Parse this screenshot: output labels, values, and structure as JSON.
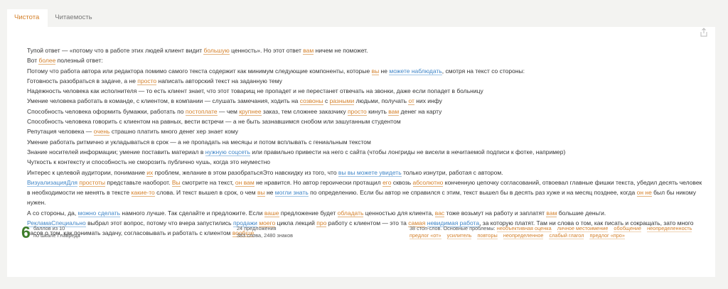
{
  "tabs": [
    {
      "label": "Чистота",
      "active": true
    },
    {
      "label": "Читаемость",
      "active": false
    }
  ],
  "paragraphs": [
    [
      {
        "t": "Тупой ответ — «потому что в работе этих людей клиент видит "
      },
      {
        "t": "большую",
        "h": "o"
      },
      {
        "t": " ценность». Но этот ответ "
      },
      {
        "t": "вам",
        "h": "o"
      },
      {
        "t": " ничем не поможет."
      }
    ],
    [
      {
        "t": "Вот "
      },
      {
        "t": "более",
        "h": "o"
      },
      {
        "t": " полезный ответ:"
      }
    ],
    [
      {
        "t": "Потому что работа автора или редактора помимо самого текста содержит как минимум следующие компоненты, которые "
      },
      {
        "t": "вы",
        "h": "o"
      },
      {
        "t": " не "
      },
      {
        "t": "можете наблюдать",
        "h": "b"
      },
      {
        "t": ", смотря на текст со стороны:"
      }
    ],
    [
      {
        "t": "Готовность разобраться в задаче, а не "
      },
      {
        "t": "просто",
        "h": "o"
      },
      {
        "t": " написать авторский текст на заданную тему"
      }
    ],
    [
      {
        "t": "Надежность человека как исполнителя — то есть клиент знает, что этот товарищ не пропадет и не перестанет отвечать на звонки, даже если попадет в больницу"
      }
    ],
    [
      {
        "t": "Умение человека работать в команде, с клиентом, в компании — слушать замечания, ходить на "
      },
      {
        "t": "созвоны",
        "h": "o"
      },
      {
        "t": " с "
      },
      {
        "t": "разными",
        "h": "o"
      },
      {
        "t": " людьми, получать "
      },
      {
        "t": "от",
        "h": "o"
      },
      {
        "t": " них инфу"
      }
    ],
    [
      {
        "t": "Способность человека оформить бумажки, работать по "
      },
      {
        "t": "постоплате",
        "h": "o"
      },
      {
        "t": " — чем "
      },
      {
        "t": "крупнее",
        "h": "o"
      },
      {
        "t": " заказ, тем сложнее заказчику "
      },
      {
        "t": "просто",
        "h": "o"
      },
      {
        "t": " кинуть "
      },
      {
        "t": "вам",
        "h": "o"
      },
      {
        "t": " денег на карту"
      }
    ],
    [
      {
        "t": "Способность человека говорить с клиентом на равных, вести встречи — а не быть зазнавшимся снобом или зашуганным студентом"
      }
    ],
    [
      {
        "t": "Репутация человека — "
      },
      {
        "t": "очень",
        "h": "o"
      },
      {
        "t": " страшно платить много денег хер знает кому"
      }
    ],
    [
      {
        "t": "Умение работать ритмично и укладываться в срок — а не пропадать на месяцы и потом всплывать с гениальным текстом"
      }
    ],
    [
      {
        "t": "Знание носителей информации; умение поставить материал в "
      },
      {
        "t": "нужную соцсеть",
        "h": "b"
      },
      {
        "t": " или правильно привести на него с сайта (чтобы лонгриды не висели в нечитаемой подписи к фотке, например)"
      }
    ],
    [
      {
        "t": "Чуткость к контексту и способность не сморозить публично чушь, когда это неуместно"
      }
    ],
    [
      {
        "t": "Интерес к целевой аудитории, понимание "
      },
      {
        "t": "их",
        "h": "o"
      },
      {
        "t": " проблем, желание в этом разобратьсяЭто навскидку из того, что "
      },
      {
        "t": "вы вы можете увидеть",
        "h": "b"
      },
      {
        "t": " только изнутри, работая с автором."
      }
    ],
    [
      {
        "t": "ВизуализацияДля",
        "h": "b"
      },
      {
        "t": " "
      },
      {
        "t": "простоты",
        "h": "o"
      },
      {
        "t": " представьте наоборот. "
      },
      {
        "t": "Вы",
        "h": "o"
      },
      {
        "t": " смотрите на текст, "
      },
      {
        "t": "он вам",
        "h": "o"
      },
      {
        "t": " не нравится. Но автор героически протащил "
      },
      {
        "t": "его",
        "h": "o"
      },
      {
        "t": " сквозь "
      },
      {
        "t": "абсолютно",
        "h": "o"
      },
      {
        "t": " конченную цепочку согласований, отвоевал главные фишки текста, убедил десять человек в необходимости не менять в тексте "
      },
      {
        "t": "какие-то",
        "h": "o"
      },
      {
        "t": " слова. И текст вышел в срок, о чем "
      },
      {
        "t": "вы",
        "h": "o"
      },
      {
        "t": " не "
      },
      {
        "t": "могли знать",
        "h": "b"
      },
      {
        "t": " по определению. Если бы автор не справился с этим, текст вышел бы в десять раз хуже и на месяц позднее, когда "
      },
      {
        "t": "он не",
        "h": "o"
      },
      {
        "t": " был бы никому нужен."
      }
    ],
    [
      {
        "t": "А со стороны, да, "
      },
      {
        "t": "можно сделать",
        "h": "b"
      },
      {
        "t": " намного лучше. Так сделайте и предложите. Если "
      },
      {
        "t": "ваше",
        "h": "o"
      },
      {
        "t": " предложение будет "
      },
      {
        "t": "обладать",
        "h": "o"
      },
      {
        "t": " ценностью для клиента, "
      },
      {
        "t": "вас",
        "h": "o"
      },
      {
        "t": " тоже возьмут на работу и заплатят "
      },
      {
        "t": "вам",
        "h": "o"
      },
      {
        "t": " большие деньги."
      }
    ],
    [
      {
        "t": "РекламаСпециально",
        "h": "b"
      },
      {
        "t": " выбрал этот вопрос, потому что вчера запустились "
      },
      {
        "t": "продажи",
        "h": "b"
      },
      {
        "t": " "
      },
      {
        "t": "моего",
        "h": "o"
      },
      {
        "t": " цикла лекций "
      },
      {
        "t": "про",
        "h": "o"
      },
      {
        "t": " работу с клиентом — это та "
      },
      {
        "t": "самая",
        "h": "o"
      },
      {
        "t": " "
      },
      {
        "t": "невидимая работа",
        "h": "b"
      },
      {
        "t": ", за которую платят. Там ни слова о том, как писать и сокращать, зато много часов о том, как понимать задачу, согласовывать и работать с клиентом "
      },
      {
        "t": "вообще",
        "h": "o"
      },
      {
        "t": "."
      }
    ]
  ],
  "footer": {
    "score": "6",
    "score_line1": "баллов из 10",
    "score_line2": "по шкале Главреда",
    "stats_line1": "24 предложения",
    "stats_line2": "383 слова, 2480 знаков",
    "problems_prefix": "38 стоп-слов. Основные проблемы:",
    "problems": [
      "необъективная оценка",
      "личное местоимение",
      "обобщение",
      "неопределенность",
      "предлог «от»",
      "усилитель",
      "повторы",
      "неопределенное",
      "слабый глагол",
      "предлог «про»"
    ]
  },
  "colors": {
    "accent": "#d4802a",
    "score": "#3f7d2b",
    "highlight_blue": "#3f85c7"
  },
  "icons": {
    "share": "share-icon"
  }
}
